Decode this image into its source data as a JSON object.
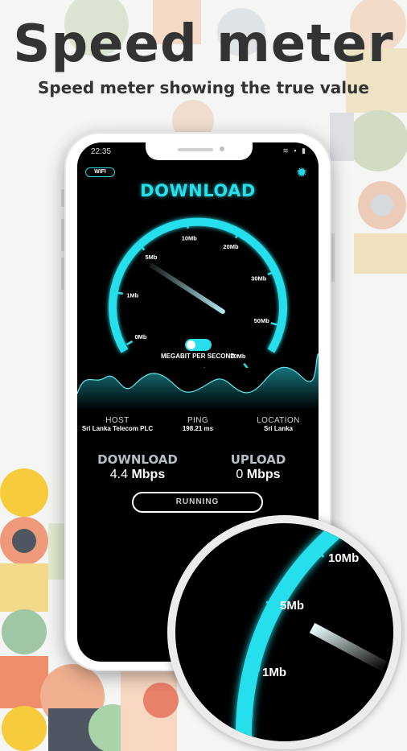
{
  "promo": {
    "headline": "Speed meter",
    "subheadline": "Speed meter showing the true value"
  },
  "status_bar": {
    "time": "22:35",
    "icons": "≋ ▪ ▮"
  },
  "wifi_badge": "WIFI",
  "settings_icon": "gear-icon",
  "screen_title": "DOWNLOAD",
  "gauge": {
    "tick_labels": [
      "0Mb",
      "1Mb",
      "5Mb",
      "10Mb",
      "20Mb",
      "30Mb",
      "50Mb",
      "70Mb",
      "100Mb"
    ],
    "needle_value_mbps": 4.4,
    "unit_caption": "MEGABIT PER SECOND",
    "toggle_on": true
  },
  "info": {
    "host_label": "HOST",
    "host_value": "Sri Lanka Telecom PLC",
    "ping_label": "PING",
    "ping_value": "198.21 ms",
    "location_label": "LOCATION",
    "location_value": "Sri Lanka"
  },
  "results": {
    "download_label": "DOWNLOAD",
    "download_value": "4.4",
    "download_unit": "Mbps",
    "upload_label": "UPLOAD",
    "upload_value": "0",
    "upload_unit": "Mbps"
  },
  "run_button": "RUNNING",
  "magnifier_labels": [
    "1Mb",
    "5Mb",
    "10Mb"
  ],
  "colors": {
    "accent": "#27dfec",
    "screen_bg": "#000000",
    "headline": "#333333"
  }
}
